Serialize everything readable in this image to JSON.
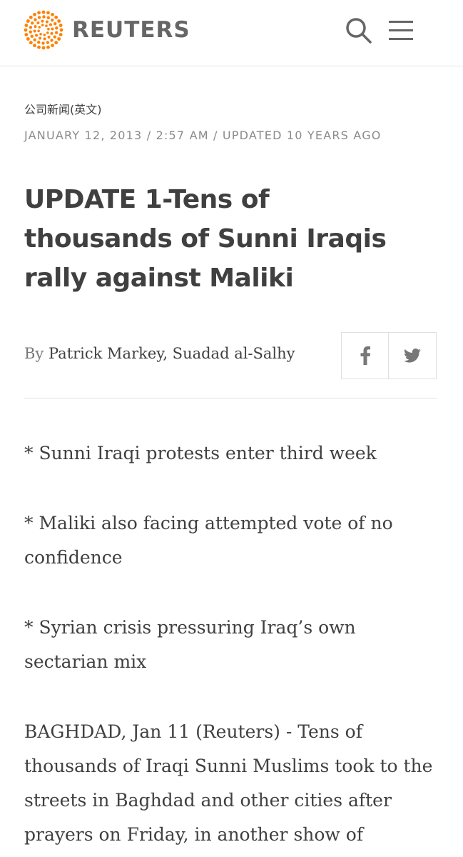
{
  "header": {
    "brand": "REUTERS",
    "icons": {
      "logo": "reuters-dot-logo",
      "search": "search-icon",
      "menu": "hamburger-menu-icon"
    },
    "accent_color": "#ff8000"
  },
  "article": {
    "category": "公司新闻(英文)",
    "dateline": "JANUARY 12, 2013 / 2:57 AM / UPDATED 10 YEARS AGO",
    "headline": "UPDATE 1-Tens of thousands of Sunni Iraqis rally against Maliki",
    "byline_prefix": "By",
    "authors": "Patrick Markey, Suadad al-Salhy",
    "share": {
      "facebook_icon": "facebook-icon",
      "twitter_icon": "twitter-icon"
    },
    "paragraphs": [
      "* Sunni Iraqi protests enter third week",
      "* Maliki also facing attempted vote of no confidence",
      "* Syrian crisis pressuring Iraq’s own sectarian mix",
      "BAGHDAD, Jan 11 (Reuters) - Tens of thousands of Iraqi Sunni Muslims took to the streets in Baghdad and other cities after prayers on Friday, in another show of"
    ]
  }
}
